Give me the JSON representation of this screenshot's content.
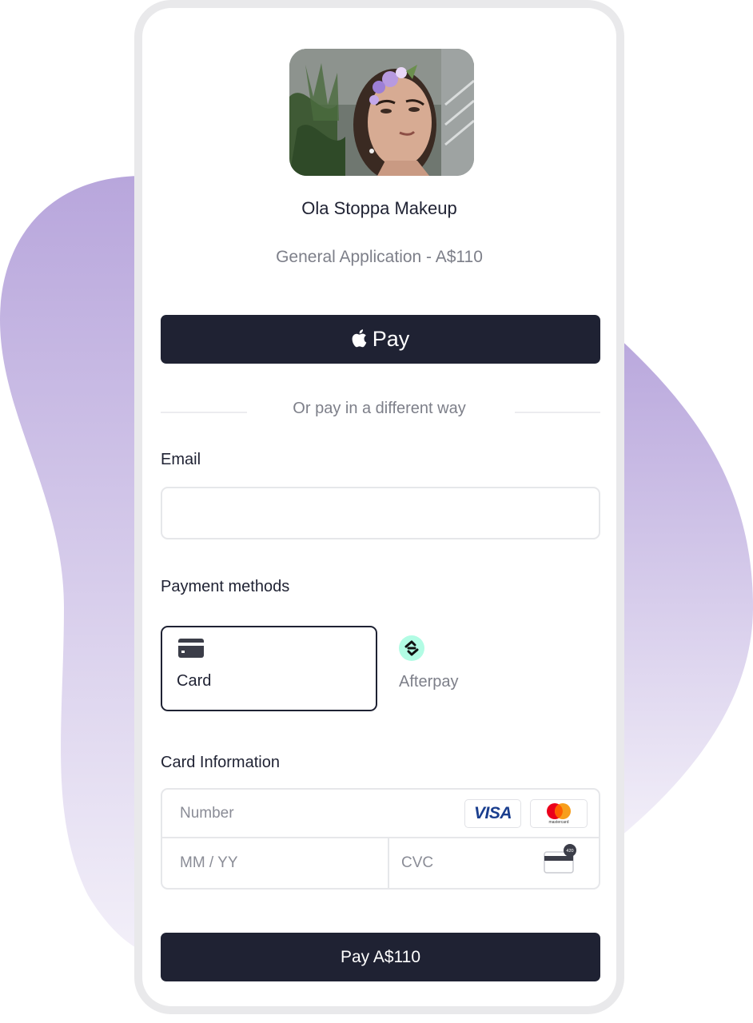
{
  "merchant": {
    "name": "Ola Stoppa Makeup",
    "product_line": "General Application - A$110"
  },
  "wallet_button": {
    "label": "Pay"
  },
  "divider": {
    "text": "Or pay in a different way"
  },
  "email": {
    "label": "Email",
    "value": "",
    "placeholder": ""
  },
  "payment_methods": {
    "label": "Payment methods",
    "items": [
      {
        "label": "Card",
        "icon": "credit-card-icon",
        "selected": true
      },
      {
        "label": "Afterpay",
        "icon": "afterpay-logo-icon",
        "selected": false
      }
    ]
  },
  "card_info": {
    "label": "Card Information",
    "number_placeholder": "Number",
    "expiry_placeholder": "MM / YY",
    "cvc_placeholder": "CVC",
    "brands": [
      {
        "name": "VISA",
        "icon": "visa-logo-icon"
      },
      {
        "name": "mastercard",
        "icon": "mastercard-logo-icon"
      }
    ],
    "cvc_icon_text": "420"
  },
  "pay_button": {
    "label": "Pay A$110"
  },
  "colors": {
    "primary": "#1f2233",
    "muted_text": "#7d7f89",
    "border": "#e6e7ea",
    "blob_top": "#b8a6dc",
    "blob_bottom": "#f1edf8",
    "afterpay_mint": "#b2fce4"
  }
}
